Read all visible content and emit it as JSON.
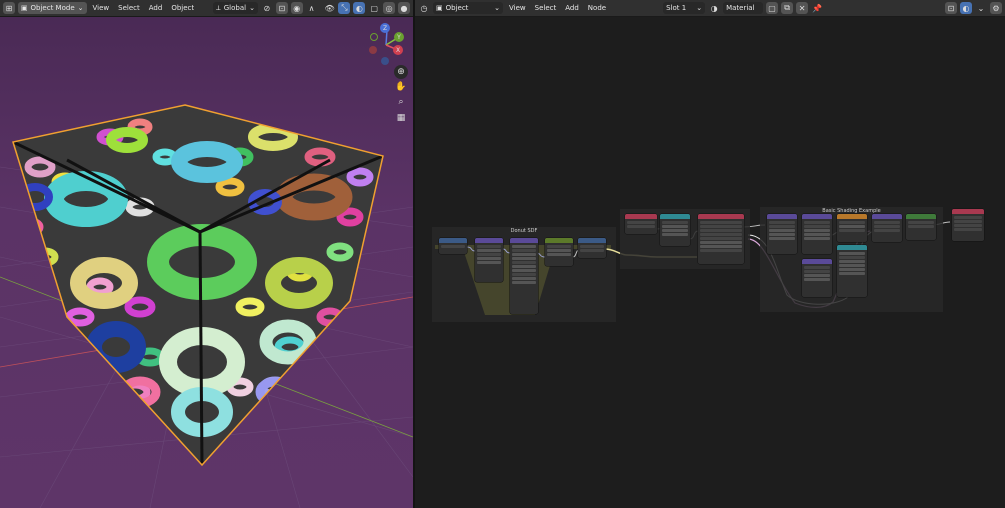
{
  "viewport_header": {
    "mode": "Object Mode",
    "menus": [
      "View",
      "Select",
      "Add",
      "Object"
    ],
    "transform_orientation": "Global"
  },
  "node_header": {
    "type": "Object",
    "menus": [
      "View",
      "Select",
      "Add",
      "Node"
    ],
    "slot": "Slot 1",
    "material": "Material"
  },
  "gizmo": {
    "z": "Z",
    "y": "Y",
    "x": "X"
  },
  "frames": {
    "donut_sdf": "Donut SDF",
    "basic_shading": "Basic Shading Example"
  },
  "colors": {
    "viewport_bg": "#5a3266",
    "cube_outline": "#f0a030",
    "frame_highlight": "#6a6a3a",
    "selected_link": "#e6dd9a",
    "node_header_blue": "#3b5a86",
    "node_header_red": "#a83950",
    "node_header_teal": "#2f8a93",
    "node_header_purple": "#5a4a98",
    "node_header_orange": "#b8782a",
    "link_pink": "#d9a7d9"
  }
}
